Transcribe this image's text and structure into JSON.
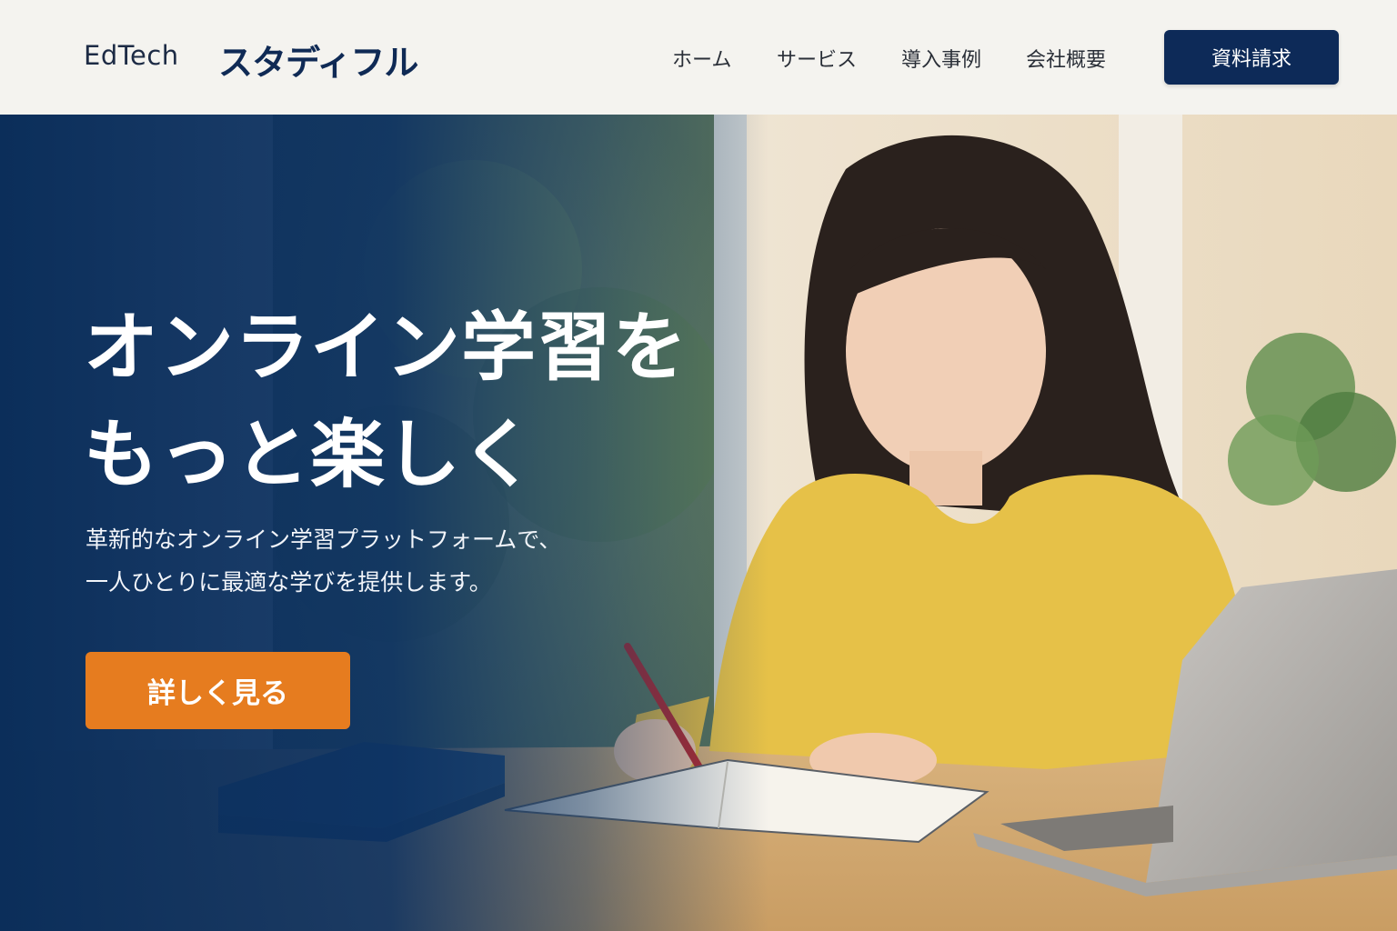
{
  "header": {
    "brand_en": "EdTech",
    "brand_ja": "スタディフル",
    "nav": [
      "ホーム",
      "サービス",
      "導入事例",
      "会社概要"
    ],
    "cta": "資料請求"
  },
  "hero": {
    "title_line1": "オンライン学習を",
    "title_line2": "もっと楽しく",
    "subtitle_line1": "革新的なオンライン学習プラットフォームで、",
    "subtitle_line2": "一人ひとりに最適な学びを提供します。",
    "cta": "詳しく見る",
    "photo": "woman-studying-with-laptop-illustration"
  },
  "colors": {
    "brand_navy": "#0d2a58",
    "accent_orange": "#e67c1f",
    "header_bg": "#f4f3ef"
  }
}
